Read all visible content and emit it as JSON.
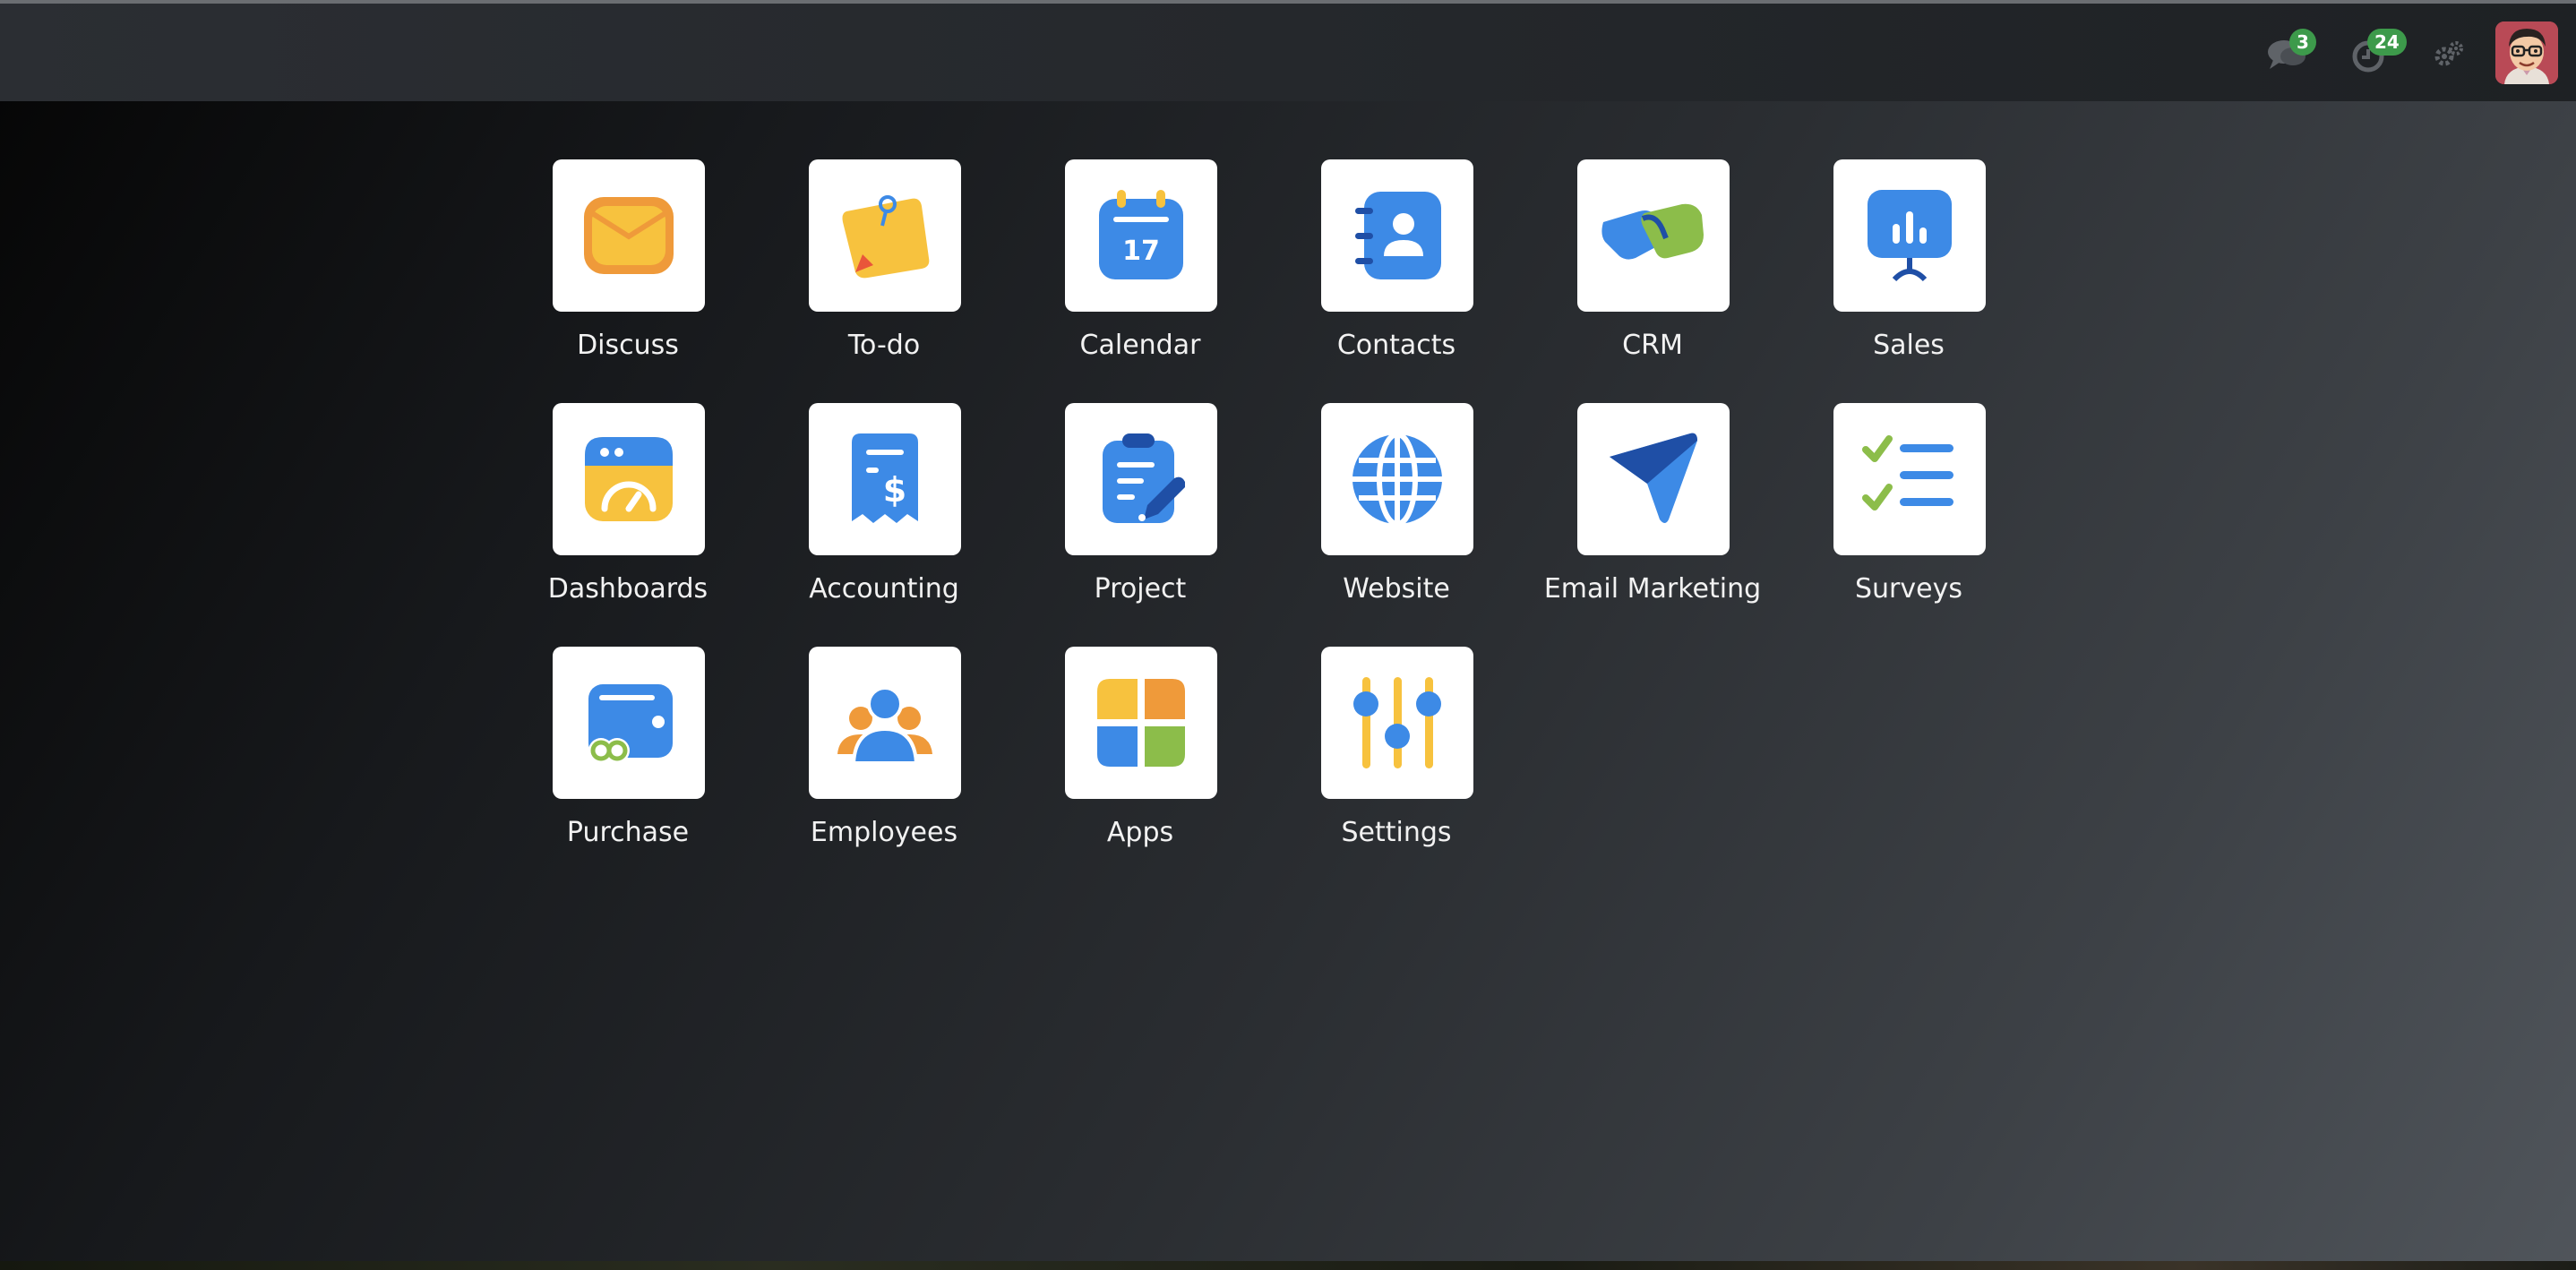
{
  "navbar": {
    "messages_badge": "3",
    "activities_badge": "24",
    "icons": [
      "chat-icon",
      "clock-icon",
      "gears-icon",
      "avatar"
    ]
  },
  "apps": [
    {
      "label": "Discuss",
      "icon": "discuss-icon"
    },
    {
      "label": "To-do",
      "icon": "todo-icon"
    },
    {
      "label": "Calendar",
      "icon": "calendar-icon",
      "date": "17"
    },
    {
      "label": "Contacts",
      "icon": "contacts-icon"
    },
    {
      "label": "CRM",
      "icon": "crm-icon"
    },
    {
      "label": "Sales",
      "icon": "sales-icon"
    },
    {
      "label": "Dashboards",
      "icon": "dashboards-icon"
    },
    {
      "label": "Accounting",
      "icon": "accounting-icon"
    },
    {
      "label": "Project",
      "icon": "project-icon"
    },
    {
      "label": "Website",
      "icon": "website-icon"
    },
    {
      "label": "Email Marketing",
      "icon": "email-marketing-icon"
    },
    {
      "label": "Surveys",
      "icon": "surveys-icon"
    },
    {
      "label": "Purchase",
      "icon": "purchase-icon"
    },
    {
      "label": "Employees",
      "icon": "employees-icon"
    },
    {
      "label": "Apps",
      "icon": "apps-icon"
    },
    {
      "label": "Settings",
      "icon": "settings-icon"
    }
  ],
  "colors": {
    "blue": "#3d8ae6",
    "dark_blue": "#1f4fa6",
    "yellow": "#f7c23e",
    "orange": "#ef9a3a",
    "green": "#8cbd4a",
    "badge_green": "#3d9a4b"
  }
}
